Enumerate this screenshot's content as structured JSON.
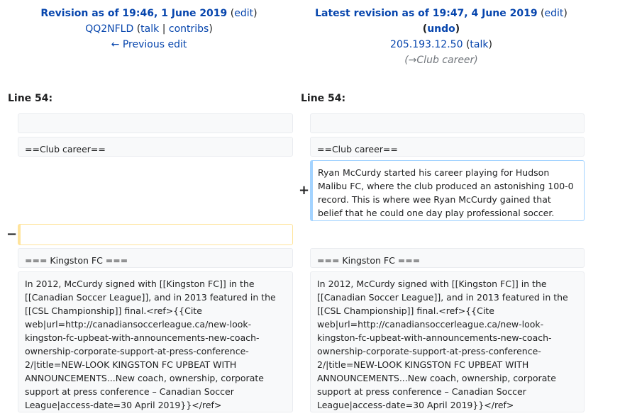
{
  "left_header": {
    "title": "Revision as of 19:46, 1 June 2019",
    "edit": "edit",
    "user": "QQ2NFLD",
    "talk": "talk",
    "contribs": "contribs",
    "prev_edit": "← Previous edit"
  },
  "right_header": {
    "title": "Latest revision as of 19:47, 4 June 2019",
    "edit": "edit",
    "undo": "undo",
    "user": "205.193.12.50",
    "talk": "talk",
    "summary": "(→Club career)"
  },
  "line_label_left": "Line 54:",
  "line_label_right": "Line 54:",
  "markers": {
    "plus": "+",
    "minus": "−"
  },
  "left": {
    "empty": "",
    "club_career": "==Club career==",
    "removed": "",
    "kingston": "=== Kingston FC ===",
    "paragraph": "In 2012, McCurdy signed with [[Kingston FC]] in the [[Canadian Soccer League]], and in 2013 featured in the [[CSL Championship]] final.<ref>{{Cite web|url=http://canadiansoccerleague.ca/new-look-kingston-fc-upbeat-with-announcements-new-coach-ownership-corporate-support-at-press-conference-2/|title=NEW-LOOK KINGSTON FC UPBEAT WITH ANNOUNCEMENTS...New coach, ownership, corporate support at press conference – Canadian Soccer League|access-date=30 April 2019}}</ref>"
  },
  "right": {
    "empty": "",
    "club_career": "==Club career==",
    "added": "Ryan McCurdy started his career playing for Hudson Malibu FC, where the club produced an astonishing 100-0 record. This is where wee Ryan McCurdy gained that belief that he could one day play professional soccer.",
    "kingston": "=== Kingston FC ===",
    "paragraph": "In 2012, McCurdy signed with [[Kingston FC]] in the [[Canadian Soccer League]], and in 2013 featured in the [[CSL Championship]] final.<ref>{{Cite web|url=http://canadiansoccerleague.ca/new-look-kingston-fc-upbeat-with-announcements-new-coach-ownership-corporate-support-at-press-conference-2/|title=NEW-LOOK KINGSTON FC UPBEAT WITH ANNOUNCEMENTS...New coach, ownership, corporate support at press conference – Canadian Soccer League|access-date=30 April 2019}}</ref>"
  },
  "colors": {
    "link": "#0645ad",
    "deleted_border": "#ffe49c",
    "added_border": "#a3d3ff",
    "context_bg": "#f8f9fa"
  }
}
